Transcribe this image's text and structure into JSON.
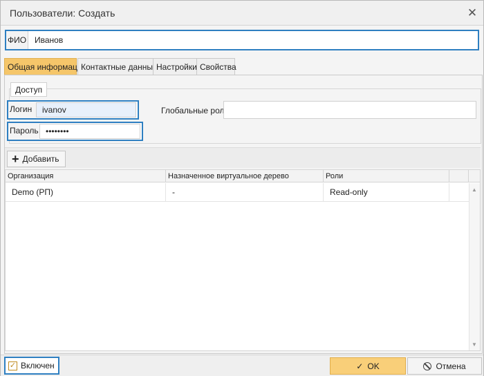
{
  "dialog": {
    "title": "Пользователи: Создать"
  },
  "fio": {
    "label": "ФИО",
    "value": "Иванов"
  },
  "tabs": [
    {
      "label": "Общая информация",
      "active": true
    },
    {
      "label": "Контактные данные",
      "active": false
    },
    {
      "label": "Настройки",
      "active": false
    },
    {
      "label": "Свойства",
      "active": false
    }
  ],
  "access": {
    "legend": "Доступ",
    "login_label": "Логин",
    "login_value": "ivanov",
    "password_label": "Пароль",
    "password_value": "••••••••",
    "global_roles_label": "Глобальные роли",
    "global_roles_value": ""
  },
  "toolbar": {
    "add_label": "Добавить"
  },
  "grid": {
    "columns": [
      "Организация",
      "Назначенное виртуальное дерево",
      "Роли"
    ],
    "rows": [
      {
        "org": "Demo (РП)",
        "tree": "-",
        "roles": "Read-only"
      }
    ]
  },
  "footer": {
    "enabled_label": "Включен",
    "enabled_checked": true,
    "ok_label": "OK",
    "cancel_label": "Отмена"
  },
  "colors": {
    "accent": "#f5c66a",
    "focus": "#2e7fc1"
  }
}
